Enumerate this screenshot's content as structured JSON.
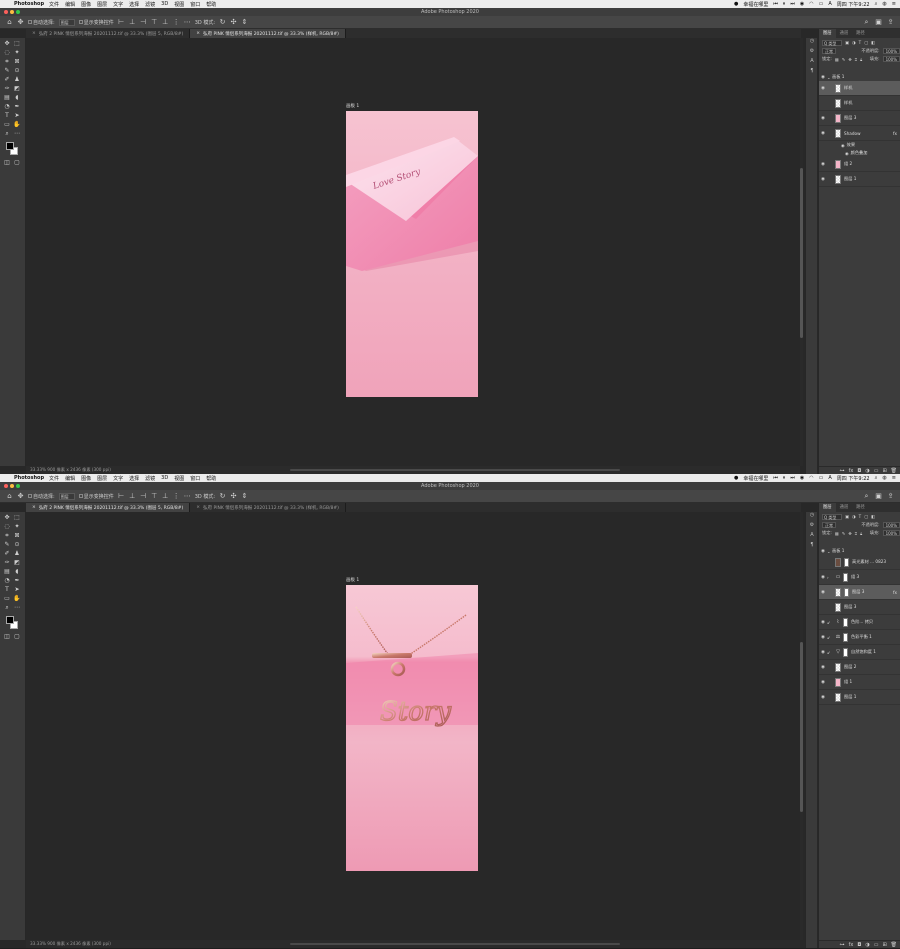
{
  "menubar": {
    "app": "Photoshop",
    "menus": [
      "文件",
      "编辑",
      "图像",
      "图层",
      "文字",
      "选择",
      "滤镜",
      "3D",
      "视图",
      "窗口",
      "帮助"
    ],
    "right_text": "幸福在哪里",
    "ime": "A",
    "clock_top": "周四 下午9:22",
    "clock_bottom": "周四 下午9:22"
  },
  "window_title": "Adobe Photoshop 2020",
  "options_bar": {
    "auto_select": "自动选择:",
    "layer_dropdown": "图层",
    "show_transform": "显示变换控件",
    "mode_3d": "3D 模式:"
  },
  "tabs": {
    "tab1": "弘府 2 PINK 情侣系列海报 20201112.tif @ 33.3% (图层 5, RGB/8#)",
    "tab2": "弘府 PINK 情侣系列海报 20201112.tif @ 33.3% (样机, RGB/8#)"
  },
  "canvas": {
    "artboard_label": "画板 1",
    "envelope_text": "Love Story",
    "necklace_text": "Story"
  },
  "status": {
    "top": "33.33%   900 像素 x 2436 像素 (300 ppi)",
    "bottom": "33.33%   900 像素 x 2436 像素 (300 ppi)"
  },
  "panel": {
    "tabs": [
      "图层",
      "通道",
      "路径"
    ],
    "filter": "Q 类型",
    "blend_mode": "正常",
    "opacity_label": "不透明度:",
    "opacity": "100%",
    "lock_label": "锁定:",
    "fill_label": "填充:",
    "fill": "100%"
  },
  "layers_top": [
    {
      "name": "画板 1"
    },
    {
      "name": "样机"
    },
    {
      "name": "样机"
    },
    {
      "name": "图层 3"
    },
    {
      "name": "Shadow"
    },
    {
      "name": "效果"
    },
    {
      "name": "颜色叠加"
    },
    {
      "name": "组 2"
    },
    {
      "name": "图层 1"
    }
  ],
  "layers_bottom": [
    {
      "name": "画板 1"
    },
    {
      "name": "高光素材 ... 0823"
    },
    {
      "name": "组 3"
    },
    {
      "name": "图层 3"
    },
    {
      "name": "图层 3"
    },
    {
      "name": "色阶... 拷贝"
    },
    {
      "name": "色彩平衡 1"
    },
    {
      "name": "自然饱和度 1"
    },
    {
      "name": "图层 2"
    },
    {
      "name": "组 1"
    },
    {
      "name": "图层 1"
    }
  ],
  "colors": {
    "pink_light": "#f7c6d3",
    "pink_mid": "#f0a0b8",
    "pink_deep": "#ee88a8",
    "canvas_bg": "#282828",
    "panel_bg": "#3c3c3c"
  }
}
